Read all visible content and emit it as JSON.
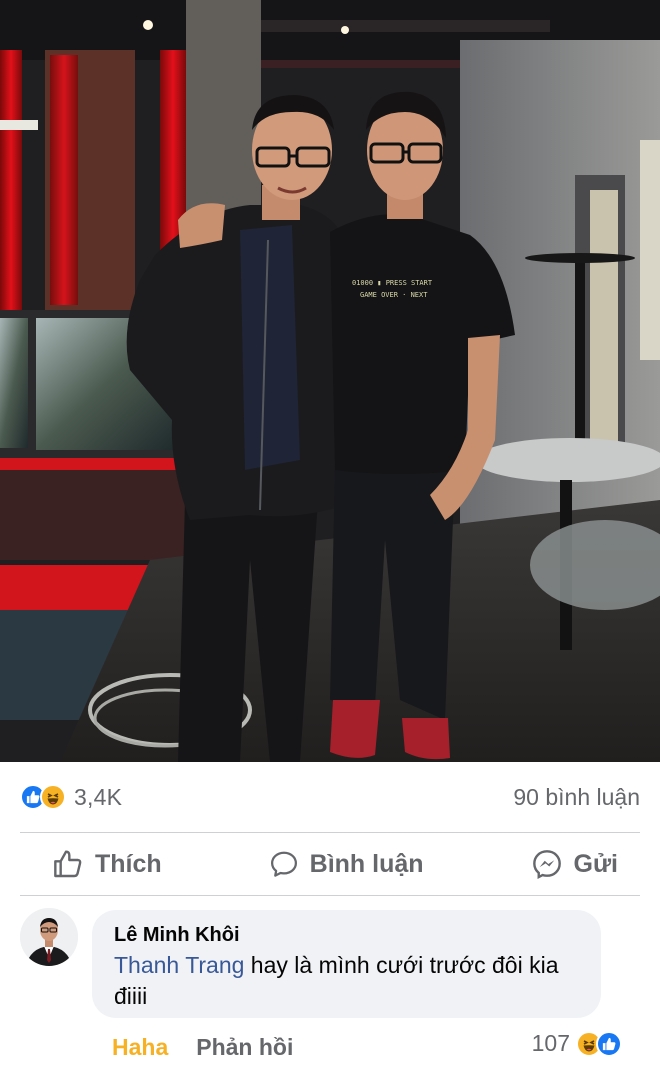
{
  "post": {
    "photo_alt": "Photo of two young men wearing glasses posing in a dimly lit gaming venue",
    "reactions": {
      "count": "3,4K",
      "types": [
        "like-icon",
        "haha-icon"
      ]
    },
    "comment_count": "90 bình luận"
  },
  "actions": {
    "like": "Thích",
    "comment": "Bình luận",
    "send": "Gửi"
  },
  "comment": {
    "author": "Lê Minh Khôi",
    "mention": "Thanh Trang",
    "text": " hay là mình cưới trước đôi kia điiii",
    "haha_label": "Haha",
    "reply_label": "Phản hồi",
    "reaction_count": "107"
  },
  "colors": {
    "like_blue": "#1877f2",
    "haha_yellow": "#f7b125",
    "mention_blue": "#385898",
    "meta_gray": "#65676b"
  }
}
